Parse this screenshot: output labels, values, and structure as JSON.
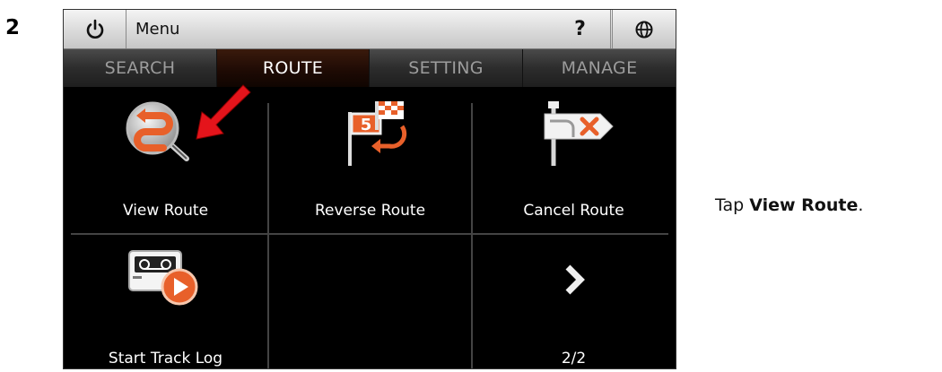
{
  "step_number": "2",
  "instruction": {
    "prefix": "Tap ",
    "bold": "View Route",
    "suffix": "."
  },
  "topbar": {
    "menu_label": "Menu",
    "help_label": "?"
  },
  "tabs": [
    {
      "label": "SEARCH",
      "active": false
    },
    {
      "label": "ROUTE",
      "active": true
    },
    {
      "label": "SETTING",
      "active": false
    },
    {
      "label": "MANAGE",
      "active": false
    }
  ],
  "grid": {
    "items": [
      {
        "label": "View Route",
        "icon": "view-route-icon"
      },
      {
        "label": "Reverse Route",
        "icon": "reverse-route-icon"
      },
      {
        "label": "Cancel Route",
        "icon": "cancel-route-icon"
      },
      {
        "label": "Start Track Log",
        "icon": "track-log-icon"
      },
      {
        "label": "",
        "icon": ""
      },
      {
        "label": "2/2",
        "icon": "next-page-icon"
      }
    ]
  },
  "colors": {
    "accent": "#e8602a",
    "pointer_arrow": "#e4141b"
  }
}
